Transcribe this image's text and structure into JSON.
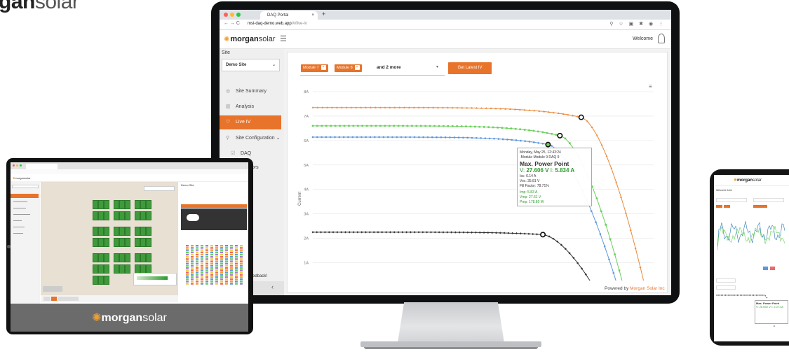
{
  "corner_brand": {
    "bold": "gan",
    "light": "solar"
  },
  "browser": {
    "tab_title": "DAQ Portal",
    "tab_close": "×",
    "new_tab": "+",
    "url_host": "msi-daq-demo.web.app",
    "url_path": "/#/live-iv",
    "nav_glyphs": "←  →  C",
    "right_icons": "⚲ ☆ ▣ ✱ ◉ ⋮"
  },
  "header": {
    "logo_bold": "morgan",
    "logo_light": "solar",
    "hamburger": "☰",
    "welcome": "Welcome"
  },
  "sidebar": {
    "section_label": "Site",
    "site_select": "Demo Site",
    "select_caret": "⌄",
    "items": [
      {
        "icon": "◎",
        "label": "Site Summary"
      },
      {
        "icon": "▥",
        "label": "Analysis"
      },
      {
        "icon": "♡",
        "label": "Live IV"
      },
      {
        "icon": "⚲",
        "label": "Site Configuration ⌄"
      },
      {
        "icon": "☑",
        "label": "DAQ"
      },
      {
        "icon": "☑",
        "label": "Sensors"
      }
    ],
    "feedback": "Feedback!",
    "collapse_icon": "‹"
  },
  "toolbar": {
    "chips": [
      "Module 7",
      "Module 8"
    ],
    "chip_x": "×",
    "more": "and 2 more",
    "caret": "▾",
    "button": "Get Latest IV",
    "menu_icon": "≡"
  },
  "footer": {
    "prefix": "Powered by ",
    "company": "Morgan Solar Inc"
  },
  "tooltip": {
    "timestamp": "Monday, May 25, 12:43:24",
    "module": "-Module Module 9 DAQ 9",
    "title": "Max. Power Point",
    "v_label": "V: ",
    "v_value": "27.606 V",
    "i_label": "I: ",
    "i_value": "5.834 A",
    "isc": "Isc: 6.14 A",
    "voc": "Voc: 35.81 V",
    "ff": "Fill Factor: 78.71%",
    "imp": "Imp: 5.83 A",
    "vmp": "Vmp: 27.61 V",
    "pmp": "Pmp: 178.80 W"
  },
  "chart_data": {
    "type": "line",
    "ylabel": "Current",
    "yticks": [
      "8A",
      "7A",
      "6A",
      "5A",
      "4A",
      "3A",
      "2A",
      "1A"
    ],
    "ylim": [
      0.5,
      8
    ],
    "xlim": [
      0,
      40
    ],
    "grid": true,
    "series": [
      {
        "color": "#e9893a",
        "marker": "triangle",
        "isc": 7.35,
        "voc": 39.0,
        "mpp": [
          31.5,
          6.95
        ]
      },
      {
        "color": "#6ad05c",
        "marker": "square",
        "isc": 6.6,
        "voc": 36.5,
        "mpp": [
          29.0,
          6.2
        ]
      },
      {
        "color": "#5d97dc",
        "marker": "circle",
        "isc": 6.14,
        "voc": 35.81,
        "mpp": [
          27.606,
          5.834
        ]
      },
      {
        "color": "#333333",
        "marker": "diamond",
        "isc": 2.25,
        "voc": 33.0,
        "mpp": [
          27.0,
          2.15
        ]
      }
    ]
  },
  "tablet": {
    "brand_bold": "morgan",
    "brand_light": "solar",
    "site_title": "Demo Site"
  },
  "phone": {
    "logo_bold": "morgan",
    "logo_light": "solar",
    "welcome": "Welcome John",
    "tip_title": "Max. Power Point",
    "tip_value": "V: 25.692 V  I: 2.071 A"
  },
  "colors": {
    "accent": "#e8732a",
    "green": "#2d9a2d"
  }
}
